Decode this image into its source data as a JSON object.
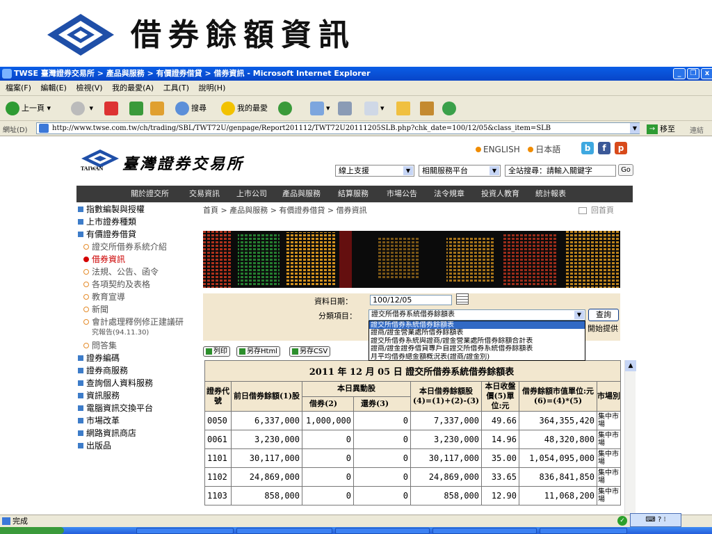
{
  "slide": {
    "title": "借券餘額資訊"
  },
  "window": {
    "title": "TWSE 臺灣證券交易所 > 產品與服務 > 有價證券借貸 > 借券資訊 - Microsoft Internet Explorer"
  },
  "menu": [
    "檔案(F)",
    "編輯(E)",
    "檢視(V)",
    "我的最愛(A)",
    "工具(T)",
    "說明(H)"
  ],
  "toolbar": {
    "back": "上一頁",
    "search": "搜尋",
    "favorites": "我的最愛"
  },
  "address": {
    "label": "網址(D)",
    "url": "http://www.twse.com.tw/ch/trading/SBL/TWT72U/genpage/Report201112/TWT72U20111205SLB.php?chk_date=100/12/05&class_item=SLB",
    "go": "移至",
    "links": "連結"
  },
  "site": {
    "name": "臺灣證券交易所",
    "name_en": "TAIWAN",
    "english": "ENGLISH",
    "japanese": "日本語",
    "support": "線上支援",
    "related": "相關服務平台",
    "search_placeholder": "全站搜尋：請輸入關鍵字",
    "go": "Go",
    "nav": [
      "關於證交所",
      "交易資訊",
      "上市公司",
      "產品與服務",
      "結算服務",
      "市場公告",
      "法令規章",
      "投資人教育",
      "統計報表"
    ]
  },
  "sidebar": [
    {
      "label": "指數編製與授權",
      "level": 0
    },
    {
      "label": "上市證券種類",
      "level": 0
    },
    {
      "label": "有價證券借貸",
      "level": 0
    },
    {
      "label": "證交所借券系統介紹",
      "level": 1
    },
    {
      "label": "借券資訊",
      "level": 1,
      "current": true
    },
    {
      "label": "法規、公告、函令",
      "level": 1
    },
    {
      "label": "各項契約及表格",
      "level": 1
    },
    {
      "label": "教育宣導",
      "level": 1
    },
    {
      "label": "新聞",
      "level": 1
    },
    {
      "label": "會計處理釋例修正建議研",
      "level": 1
    },
    {
      "label": "究報告(94.11.30)",
      "level": 2
    },
    {
      "label": "問答集",
      "level": 1
    },
    {
      "label": "證券編碼",
      "level": 0
    },
    {
      "label": "證券商服務",
      "level": 0
    },
    {
      "label": "查詢個人資料服務",
      "level": 0
    },
    {
      "label": "資訊服務",
      "level": 0
    },
    {
      "label": "電腦資訊交換平台",
      "level": 0
    },
    {
      "label": "市場改革",
      "level": 0
    },
    {
      "label": "網路資訊商店",
      "level": 0
    },
    {
      "label": "出版品",
      "level": 0
    }
  ],
  "breadcrumb": "首頁 > 產品與服務 > 有價證券借貸 > 借券資訊",
  "home_link": "回首頁",
  "filter": {
    "date_label": "資料日期：",
    "date_value": "100/12/05",
    "category_label": "分類項目：",
    "category_value": "證交所借券系統借券餘額表",
    "query": "查詢",
    "options": [
      "證交所借券系統借券餘額表",
      "證商/證金營業處所借券餘額表",
      "證交所借券系統與證商/證金營業處所借券餘額合計表",
      "證商/證金證券借貸專戶自證交所借券系統借券餘額表",
      "月平均借券總金額概況表(證商/證金別)"
    ],
    "start_text": "開始提供"
  },
  "export": {
    "print": "列印",
    "html": "另存Html",
    "csv": "另存CSV"
  },
  "table": {
    "caption": "2011 年 12 月 05 日 證交所借券系統借券餘額表",
    "headers": {
      "code": "證券代號",
      "prev": "前日借券餘額(1)股",
      "change": "本日異動股",
      "borrow": "借券(2)",
      "return": "還券(3)",
      "balance": "本日借券餘額股(4)=(1)+(2)-(3)",
      "close": "本日收盤價(5)單位:元",
      "value": "借券餘額市值單位:元(6)=(4)*(5)",
      "market": "市場別"
    },
    "rows": [
      {
        "code": "0050",
        "prev": "6,337,000",
        "borrow": "1,000,000",
        "ret": "0",
        "bal": "7,337,000",
        "close": "49.66",
        "val": "364,355,420",
        "mkt": "集中市場"
      },
      {
        "code": "0061",
        "prev": "3,230,000",
        "borrow": "0",
        "ret": "0",
        "bal": "3,230,000",
        "close": "14.96",
        "val": "48,320,800",
        "mkt": "集中市場"
      },
      {
        "code": "1101",
        "prev": "30,117,000",
        "borrow": "0",
        "ret": "0",
        "bal": "30,117,000",
        "close": "35.00",
        "val": "1,054,095,000",
        "mkt": "集中市場"
      },
      {
        "code": "1102",
        "prev": "24,869,000",
        "borrow": "0",
        "ret": "0",
        "bal": "24,869,000",
        "close": "33.65",
        "val": "836,841,850",
        "mkt": "集中市場"
      },
      {
        "code": "1103",
        "prev": "858,000",
        "borrow": "0",
        "ret": "0",
        "bal": "858,000",
        "close": "12.90",
        "val": "11,068,200",
        "mkt": "集中市場"
      }
    ]
  },
  "status": {
    "text": "完成"
  }
}
